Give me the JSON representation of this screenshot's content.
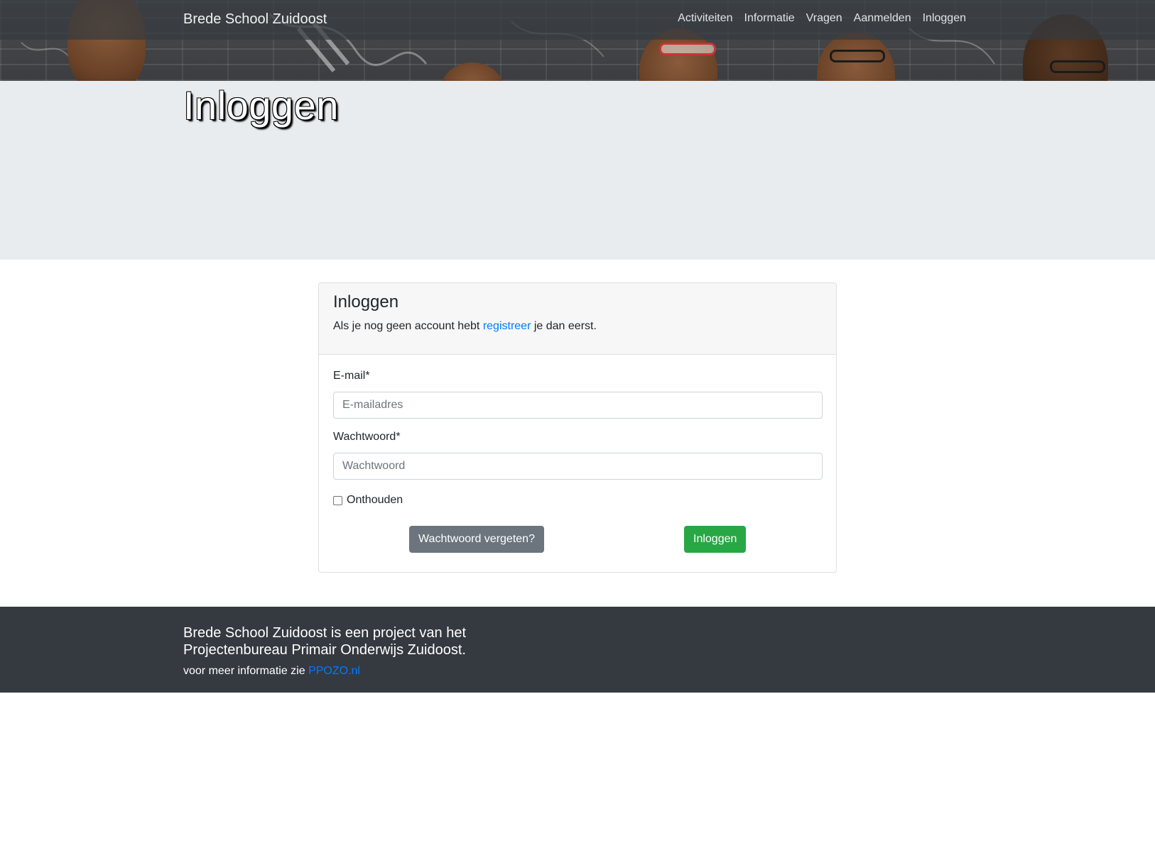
{
  "navbar": {
    "brand": "Brede School Zuidoost",
    "items": [
      {
        "label": "Activiteiten"
      },
      {
        "label": "Informatie"
      },
      {
        "label": "Vragen"
      },
      {
        "label": "Aanmelden"
      },
      {
        "label": "Inloggen"
      }
    ]
  },
  "jumbotron": {
    "title": "Inloggen"
  },
  "card": {
    "title": "Inloggen",
    "subtitle_before": "Als je nog geen account hebt",
    "register_link": "registreer",
    "subtitle_after": "je dan eerst.",
    "email_label": "E-mail*",
    "email_placeholder": "E-mailadres",
    "email_value": "",
    "password_label": "Wachtwoord*",
    "password_placeholder": "Wachtwoord",
    "password_value": "",
    "remember_label": "Onthouden",
    "remember_checked": false,
    "forgot_button": "Wachtwoord vergeten?",
    "login_button": "Inloggen"
  },
  "footer": {
    "text": "Brede School Zuidoost is een project van het Projectenbureau Primair Onderwijs Zuidoost.",
    "more_prefix": "voor meer informatie zie",
    "more_link": "PPOZO.nl"
  },
  "colors": {
    "navbar_bg": "#343a40",
    "jumbotron_bg": "#e9ecef",
    "link": "#007bff",
    "btn_secondary": "#6c757d",
    "btn_success": "#28a745",
    "footer_bg": "#343a40"
  }
}
